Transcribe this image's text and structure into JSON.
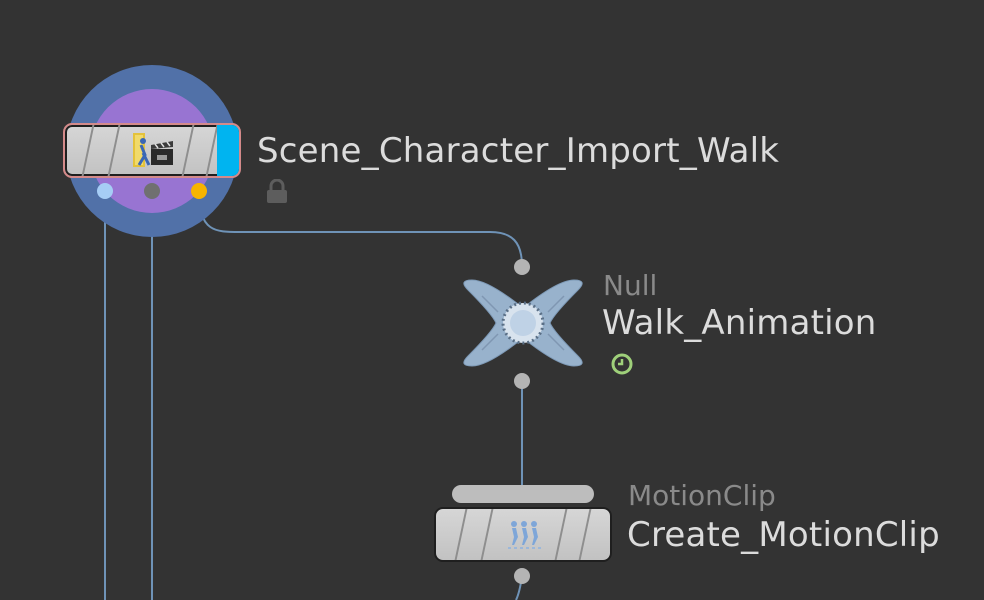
{
  "nodes": {
    "scene": {
      "name": "Scene_Character_Import_Walk",
      "icon": "lock-icon",
      "colors": {
        "outer_ring": "#5171a8",
        "inner_ring": "#9874d2",
        "display_flag": "#00b4f0",
        "node_outline": "#d48a8a",
        "port_left": "#a6cdf5",
        "port_mid": "#707070",
        "port_right": "#f7b400"
      }
    },
    "walk": {
      "type": "Null",
      "name": "Walk_Animation",
      "icon": "clock-icon",
      "colors": {
        "body": "#98b2cc",
        "clock": "#9fd07a"
      }
    },
    "motionclip": {
      "type": "MotionClip",
      "name": "Create_MotionClip"
    }
  },
  "colors": {
    "background": "#333333",
    "wire": "#6f93b7",
    "port_gray": "#b4b4b4"
  }
}
